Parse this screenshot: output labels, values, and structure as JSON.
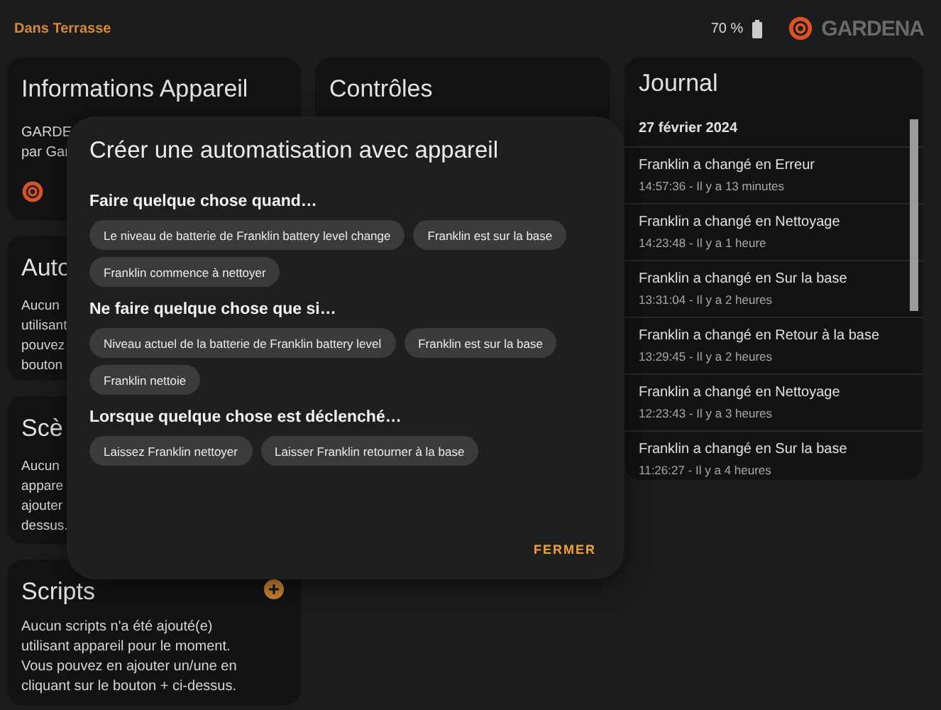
{
  "header": {
    "area": "Dans Terrasse",
    "battery": "70 %",
    "logo": "GARDENA"
  },
  "device_info": {
    "title": "Informations Appareil",
    "lines": [
      "GARDE",
      "par Gar"
    ]
  },
  "automations": {
    "title": "Auto",
    "lines": [
      "Aucun",
      "utilisant",
      "pouvez",
      "bouton"
    ]
  },
  "scenes": {
    "title": "Scè",
    "lines": [
      "Aucun",
      "appare",
      "ajouter",
      "dessus."
    ]
  },
  "scripts": {
    "title": "Scripts",
    "text": "Aucun scripts n'a été ajouté(e) utilisant appareil pour le moment. Vous pouvez en ajouter un/une en cliquant sur le bouton + ci-dessus."
  },
  "controls": {
    "title": "Contrôles"
  },
  "journal": {
    "title": "Journal",
    "date": "27 février 2024",
    "entries": [
      {
        "text": "Franklin a changé en Erreur",
        "time": "14:57:36 - Il y a 13 minutes"
      },
      {
        "text": "Franklin a changé en Nettoyage",
        "time": "14:23:48 - Il y a 1 heure"
      },
      {
        "text": "Franklin a changé en Sur la base",
        "time": "13:31:04 - Il y a 2 heures"
      },
      {
        "text": "Franklin a changé en Retour à la base",
        "time": "13:29:45 - Il y a 2 heures"
      },
      {
        "text": "Franklin a changé en Nettoyage",
        "time": "12:23:43 - Il y a 3 heures"
      },
      {
        "text": "Franklin a changé en Sur la base",
        "time": "11:26:27 - Il y a 4 heures"
      }
    ]
  },
  "dialog": {
    "title": "Créer une automatisation avec appareil",
    "sections": [
      {
        "heading": "Faire quelque chose quand…",
        "chips": [
          "Le niveau de batterie de Franklin battery level change",
          "Franklin est sur la base",
          "Franklin commence à nettoyer"
        ]
      },
      {
        "heading": "Ne faire quelque chose que si…",
        "chips": [
          "Niveau actuel de la batterie de Franklin battery level",
          "Franklin est sur la base",
          "Franklin nettoie"
        ]
      },
      {
        "heading": "Lorsque quelque chose est déclenché…",
        "chips": [
          "Laissez Franklin nettoyer",
          "Laisser Franklin retourner à la base"
        ]
      }
    ],
    "close": "FERMER"
  }
}
